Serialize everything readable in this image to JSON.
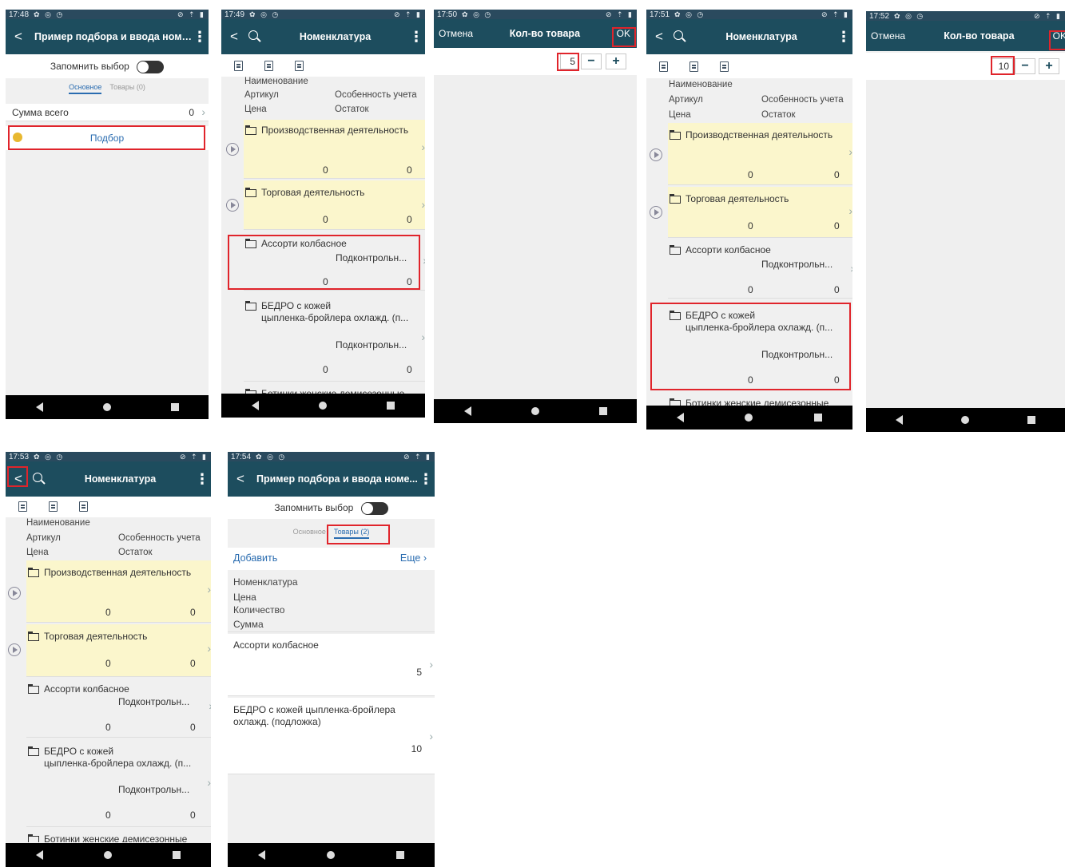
{
  "colors": {
    "header": "#1d4d5e",
    "status": "#2a4a5e",
    "highlight": "#e0242b",
    "folder_bg": "#fbf6cc",
    "link": "#2a6cb0"
  },
  "status_icons": "✿ ◎ ◷",
  "status_right": "⊘ ⇡ ▮",
  "s1": {
    "time": "17:48",
    "title": "Пример подбора и ввода номе...",
    "remember_label": "Запомнить выбор",
    "tab_main": "Основное",
    "tab_goods": "Товары (0)",
    "sum_label": "Сумма всего",
    "sum_value": "0",
    "pick_label": "Подбор"
  },
  "catalog": {
    "title": "Номенклатура",
    "col_name": "Наименование",
    "col_article": "Артикул",
    "col_feature": "Особенность учета",
    "col_price": "Цена",
    "col_stock": "Остаток",
    "items": [
      {
        "name": "Производственная деятельность",
        "zero1": "0",
        "zero2": "0"
      },
      {
        "name": "Торговая деятельность",
        "zero1": "0",
        "zero2": "0"
      },
      {
        "name": "Ассорти колбасное",
        "feature": "Подконтрольн...",
        "zero1": "0",
        "zero2": "0"
      },
      {
        "name1": "БЕДРО с кожей",
        "name2": "цыпленка-бройлера охлажд. (п...",
        "feature": "Подконтрольн...",
        "zero1": "0",
        "zero2": "0"
      },
      {
        "name": "Ботинки женские демисезонные"
      }
    ]
  },
  "s2": {
    "time": "17:49"
  },
  "s3": {
    "time": "17:50",
    "cancel": "Отмена",
    "title": "Кол-во товара",
    "ok": "OK",
    "qty": "5",
    "minus": "−",
    "plus": "+"
  },
  "s4": {
    "time": "17:51"
  },
  "s5": {
    "time": "17:52",
    "cancel": "Отмена",
    "title": "Кол-во товара",
    "ok": "OK",
    "qty": "10",
    "minus": "−",
    "plus": "+"
  },
  "s6": {
    "time": "17:53"
  },
  "s7": {
    "time": "17:54",
    "title": "Пример подбора и ввода номе...",
    "remember_label": "Запомнить выбор",
    "tab_main": "Основное",
    "tab_goods": "Товары (2)",
    "add": "Добавить",
    "more": "Еще",
    "col_nom": "Номенклатура",
    "col_price": "Цена",
    "col_qty": "Количество",
    "col_sum": "Сумма",
    "rows": [
      {
        "name1": "Ассорти колбасное",
        "name2": "",
        "qty": "5"
      },
      {
        "name1": "БЕДРО с кожей цыпленка-бройлера",
        "name2": "охлажд. (подложка)",
        "qty": "10"
      }
    ]
  }
}
